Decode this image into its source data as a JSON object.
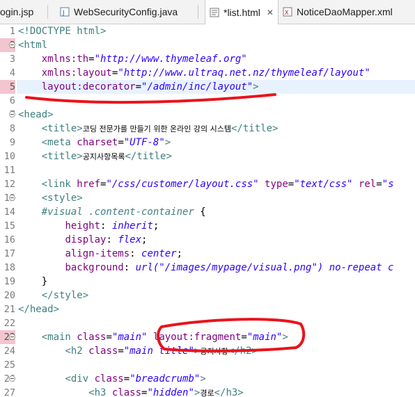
{
  "tabs": [
    {
      "label": "ogin.jsp",
      "icon": "jsp-file-icon",
      "active": false
    },
    {
      "label": "WebSecurityConfig.java",
      "icon": "java-file-icon",
      "active": false
    },
    {
      "label": "*list.html",
      "icon": "html-file-icon",
      "active": true,
      "close": "✕"
    },
    {
      "label": "NoticeDaoMapper.xml",
      "icon": "xml-file-icon",
      "active": false
    }
  ],
  "lines": [
    {
      "n": "1",
      "fold": false,
      "hl": false,
      "parts": [
        [
          "t-tag",
          "<!DOCTYPE html>"
        ]
      ]
    },
    {
      "n": "2",
      "fold": true,
      "hl": true,
      "parts": [
        [
          "t-tag",
          "<html"
        ]
      ]
    },
    {
      "n": "3",
      "fold": false,
      "hl": false,
      "parts": [
        [
          "t-txt",
          "    "
        ],
        [
          "t-attr",
          "xmlns:th"
        ],
        [
          "t-txt",
          "="
        ],
        [
          "t-str",
          "\"http://www.thymeleaf.org\""
        ]
      ]
    },
    {
      "n": "4",
      "fold": false,
      "hl": false,
      "parts": [
        [
          "t-txt",
          "    "
        ],
        [
          "t-attr",
          "xmlns:layout"
        ],
        [
          "t-txt",
          "="
        ],
        [
          "t-str",
          "\"http://www.ultraq.net.nz/thymeleaf/layout\""
        ]
      ]
    },
    {
      "n": "5",
      "fold": false,
      "hl": true,
      "current": true,
      "parts": [
        [
          "t-txt",
          "    "
        ],
        [
          "t-attr",
          "layout:decorator"
        ],
        [
          "t-txt",
          "="
        ],
        [
          "t-str",
          "\"/admin/inc/layout\""
        ],
        [
          "t-tag",
          ">"
        ]
      ]
    },
    {
      "n": "6",
      "fold": false,
      "hl": false,
      "parts": []
    },
    {
      "n": "7",
      "fold": true,
      "hl": false,
      "parts": [
        [
          "t-tag",
          "<head>"
        ]
      ]
    },
    {
      "n": "8",
      "fold": false,
      "hl": false,
      "parts": [
        [
          "t-txt",
          "    "
        ],
        [
          "t-tag",
          "<title>"
        ],
        [
          "t-ko",
          "코딩 전문가를 만들기 위한 온라인 강의 시스템"
        ],
        [
          "t-tag",
          "</title>"
        ]
      ]
    },
    {
      "n": "9",
      "fold": false,
      "hl": false,
      "parts": [
        [
          "t-txt",
          "    "
        ],
        [
          "t-tag",
          "<meta "
        ],
        [
          "t-attr",
          "charset"
        ],
        [
          "t-txt",
          "="
        ],
        [
          "t-str",
          "\"UTF-8\""
        ],
        [
          "t-tag",
          ">"
        ]
      ]
    },
    {
      "n": "10",
      "fold": false,
      "hl": false,
      "parts": [
        [
          "t-txt",
          "    "
        ],
        [
          "t-tag",
          "<title>"
        ],
        [
          "t-ko",
          "공지사항목록"
        ],
        [
          "t-tag",
          "</title>"
        ]
      ]
    },
    {
      "n": "11",
      "fold": false,
      "hl": false,
      "parts": []
    },
    {
      "n": "12",
      "fold": false,
      "hl": false,
      "parts": [
        [
          "t-txt",
          "    "
        ],
        [
          "t-tag",
          "<link "
        ],
        [
          "t-attr",
          "href"
        ],
        [
          "t-txt",
          "="
        ],
        [
          "t-str",
          "\"/css/customer/layout.css\""
        ],
        [
          "t-txt",
          " "
        ],
        [
          "t-attr",
          "type"
        ],
        [
          "t-txt",
          "="
        ],
        [
          "t-str",
          "\"text/css\""
        ],
        [
          "t-txt",
          " "
        ],
        [
          "t-attr",
          "rel"
        ],
        [
          "t-txt",
          "="
        ],
        [
          "t-str",
          "\"s"
        ]
      ]
    },
    {
      "n": "13",
      "fold": true,
      "hl": false,
      "parts": [
        [
          "t-txt",
          "    "
        ],
        [
          "t-tag",
          "<style>"
        ]
      ]
    },
    {
      "n": "14",
      "fold": false,
      "hl": false,
      "parts": [
        [
          "t-txt",
          "    "
        ],
        [
          "t-css-sel",
          "#visual .content-container"
        ],
        [
          "t-txt",
          " {"
        ]
      ]
    },
    {
      "n": "15",
      "fold": false,
      "hl": false,
      "parts": [
        [
          "t-txt",
          "        "
        ],
        [
          "t-css-prop",
          "height"
        ],
        [
          "t-txt",
          ": "
        ],
        [
          "t-css-val",
          "inherit"
        ],
        [
          "t-txt",
          ";"
        ]
      ]
    },
    {
      "n": "16",
      "fold": false,
      "hl": false,
      "parts": [
        [
          "t-txt",
          "        "
        ],
        [
          "t-css-prop",
          "display"
        ],
        [
          "t-txt",
          ": "
        ],
        [
          "t-css-val",
          "flex"
        ],
        [
          "t-txt",
          ";"
        ]
      ]
    },
    {
      "n": "17",
      "fold": false,
      "hl": false,
      "parts": [
        [
          "t-txt",
          "        "
        ],
        [
          "t-css-prop",
          "align-items"
        ],
        [
          "t-txt",
          ": "
        ],
        [
          "t-css-val",
          "center"
        ],
        [
          "t-txt",
          ";"
        ]
      ]
    },
    {
      "n": "18",
      "fold": false,
      "hl": false,
      "parts": [
        [
          "t-txt",
          "        "
        ],
        [
          "t-css-prop",
          "background"
        ],
        [
          "t-txt",
          ": "
        ],
        [
          "t-css-val",
          "url(\"/images/mypage/visual.png\") no-repeat c"
        ]
      ]
    },
    {
      "n": "19",
      "fold": false,
      "hl": false,
      "parts": [
        [
          "t-txt",
          "    }"
        ]
      ]
    },
    {
      "n": "20",
      "fold": false,
      "hl": false,
      "parts": [
        [
          "t-txt",
          "    "
        ],
        [
          "t-tag",
          "</style>"
        ]
      ]
    },
    {
      "n": "21",
      "fold": false,
      "hl": false,
      "parts": [
        [
          "t-tag",
          "</head>"
        ]
      ]
    },
    {
      "n": "22",
      "fold": false,
      "hl": false,
      "parts": []
    },
    {
      "n": "23",
      "fold": true,
      "hl": true,
      "parts": [
        [
          "t-txt",
          "    "
        ],
        [
          "t-tag",
          "<main "
        ],
        [
          "t-attr",
          "class"
        ],
        [
          "t-txt",
          "="
        ],
        [
          "t-str",
          "\"main\""
        ],
        [
          "t-txt",
          " "
        ],
        [
          "t-attr",
          "layout:fragment"
        ],
        [
          "t-txt",
          "="
        ],
        [
          "t-str",
          "\"main\""
        ],
        [
          "t-tag",
          ">"
        ]
      ]
    },
    {
      "n": "24",
      "fold": false,
      "hl": false,
      "parts": [
        [
          "t-txt",
          "        "
        ],
        [
          "t-tag",
          "<h2 "
        ],
        [
          "t-attr",
          "class"
        ],
        [
          "t-txt",
          "="
        ],
        [
          "t-str",
          "\"main title\""
        ],
        [
          "t-tag",
          ">"
        ],
        [
          "t-ko",
          "공지사항"
        ],
        [
          "t-tag",
          "</h2>"
        ]
      ]
    },
    {
      "n": "25",
      "fold": false,
      "hl": false,
      "parts": []
    },
    {
      "n": "26",
      "fold": true,
      "hl": false,
      "parts": [
        [
          "t-txt",
          "        "
        ],
        [
          "t-tag",
          "<div "
        ],
        [
          "t-attr",
          "class"
        ],
        [
          "t-txt",
          "="
        ],
        [
          "t-str",
          "\"breadcrumb\""
        ],
        [
          "t-tag",
          ">"
        ]
      ]
    },
    {
      "n": "27",
      "fold": false,
      "hl": false,
      "parts": [
        [
          "t-txt",
          "            "
        ],
        [
          "t-tag",
          "<h3 "
        ],
        [
          "t-attr",
          "class"
        ],
        [
          "t-txt",
          "="
        ],
        [
          "t-str",
          "\"hidden\""
        ],
        [
          "t-tag",
          ">"
        ],
        [
          "t-ko",
          "경로"
        ],
        [
          "t-tag",
          "</h3>"
        ]
      ]
    }
  ],
  "colors": {
    "annotation": "#e8141c",
    "line_highlight": "#f3c6cf",
    "current_line": "#e8f2fe"
  }
}
